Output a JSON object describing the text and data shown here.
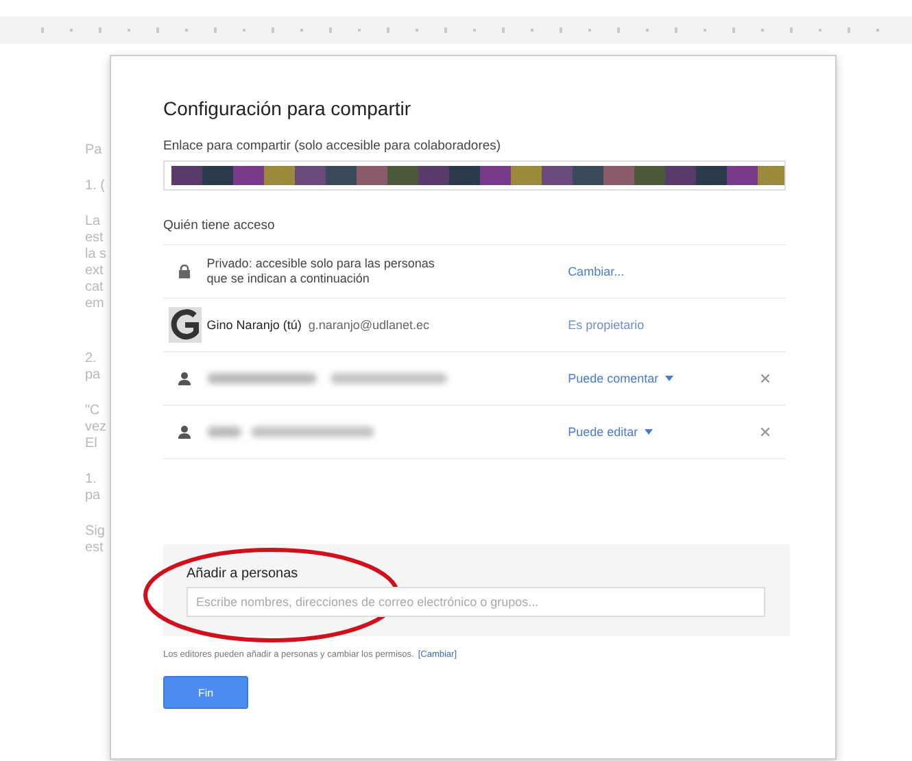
{
  "document": {
    "visible_text": [
      {
        "text": "Pa"
      },
      {
        "text": "1. ("
      },
      {
        "text": "La"
      },
      {
        "text": "est"
      },
      {
        "text": "la s"
      },
      {
        "text": "ext"
      },
      {
        "text": "cat"
      },
      {
        "text": "em"
      },
      {
        "text": "2."
      },
      {
        "text": "pa"
      },
      {
        "text": "\"C"
      },
      {
        "text": "vez"
      },
      {
        "text": "El"
      },
      {
        "text": "1."
      },
      {
        "text": "pa"
      },
      {
        "text": "Sig"
      },
      {
        "text": "est"
      }
    ]
  },
  "dialog": {
    "title": "Configuración para compartir",
    "link_label": "Enlace para compartir (solo accesible para colaboradores)",
    "link": {
      "redacted": true
    },
    "access_heading": "Quién tiene acceso",
    "entries": [
      {
        "kind": "visibility",
        "text": "Privado: accesible solo para las personas que se indican a continuación",
        "action": "Cambiar...",
        "removable": false
      },
      {
        "kind": "owner",
        "name": "Gino Naranjo (tú)",
        "email": "g.naranjo@udlanet.ec",
        "action": "Es propietario",
        "removable": false
      },
      {
        "kind": "collaborator",
        "redacted": true,
        "action": "Puede comentar",
        "dropdown": true,
        "removable": true
      },
      {
        "kind": "collaborator",
        "redacted": true,
        "action": "Puede editar",
        "dropdown": true,
        "removable": true
      }
    ],
    "add_people": {
      "label": "Añadir a personas",
      "placeholder": "Escribe nombres, direcciones de correo electrónico o grupos...",
      "highlighted": true
    },
    "note": "Los editores pueden añadir a personas y cambiar los permisos.",
    "note_link": "[Cambiar]",
    "button": "Fin"
  }
}
